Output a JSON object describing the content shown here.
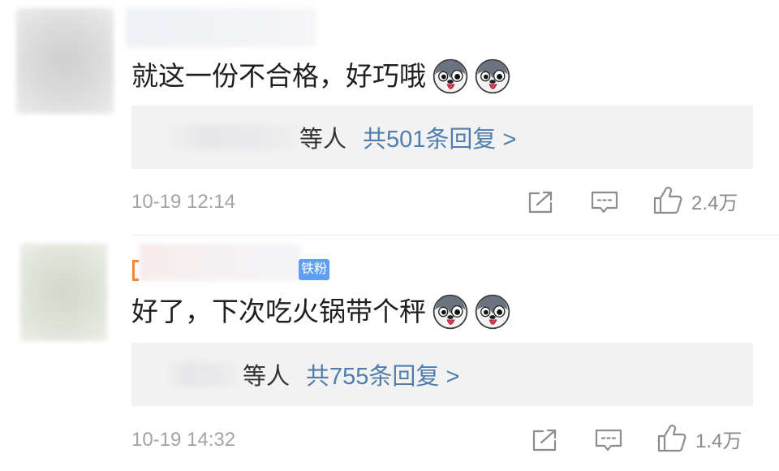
{
  "comments": [
    {
      "text": "就这一份不合格，好巧哦",
      "emojis": [
        "husky-emoji",
        "husky-emoji"
      ],
      "reply_summary": {
        "suffix": "等人",
        "link": "共501条回复 >"
      },
      "time": "10-19 12:14",
      "actions": {
        "share_icon": "share-icon",
        "comment_icon": "comment-icon",
        "like_icon": "like-icon",
        "likes": "2.4万"
      }
    },
    {
      "badge": "铁粉",
      "text": "好了，下次吃火锅带个秤",
      "emojis": [
        "husky-emoji",
        "husky-emoji"
      ],
      "reply_summary": {
        "suffix": "等人",
        "link": "共755条回复 >"
      },
      "time": "10-19 14:32",
      "actions": {
        "share_icon": "share-icon",
        "comment_icon": "comment-icon",
        "like_icon": "like-icon",
        "likes": "1.4万"
      }
    }
  ],
  "colors": {
    "text": "#1f1f1f",
    "link": "#507daf",
    "meta": "#a3a3a3",
    "reply_bg": "#f2f2f2",
    "badge_bg": "#5e9ff2",
    "username_accent": "#f08a3c",
    "icon": "#8c8c8c"
  }
}
